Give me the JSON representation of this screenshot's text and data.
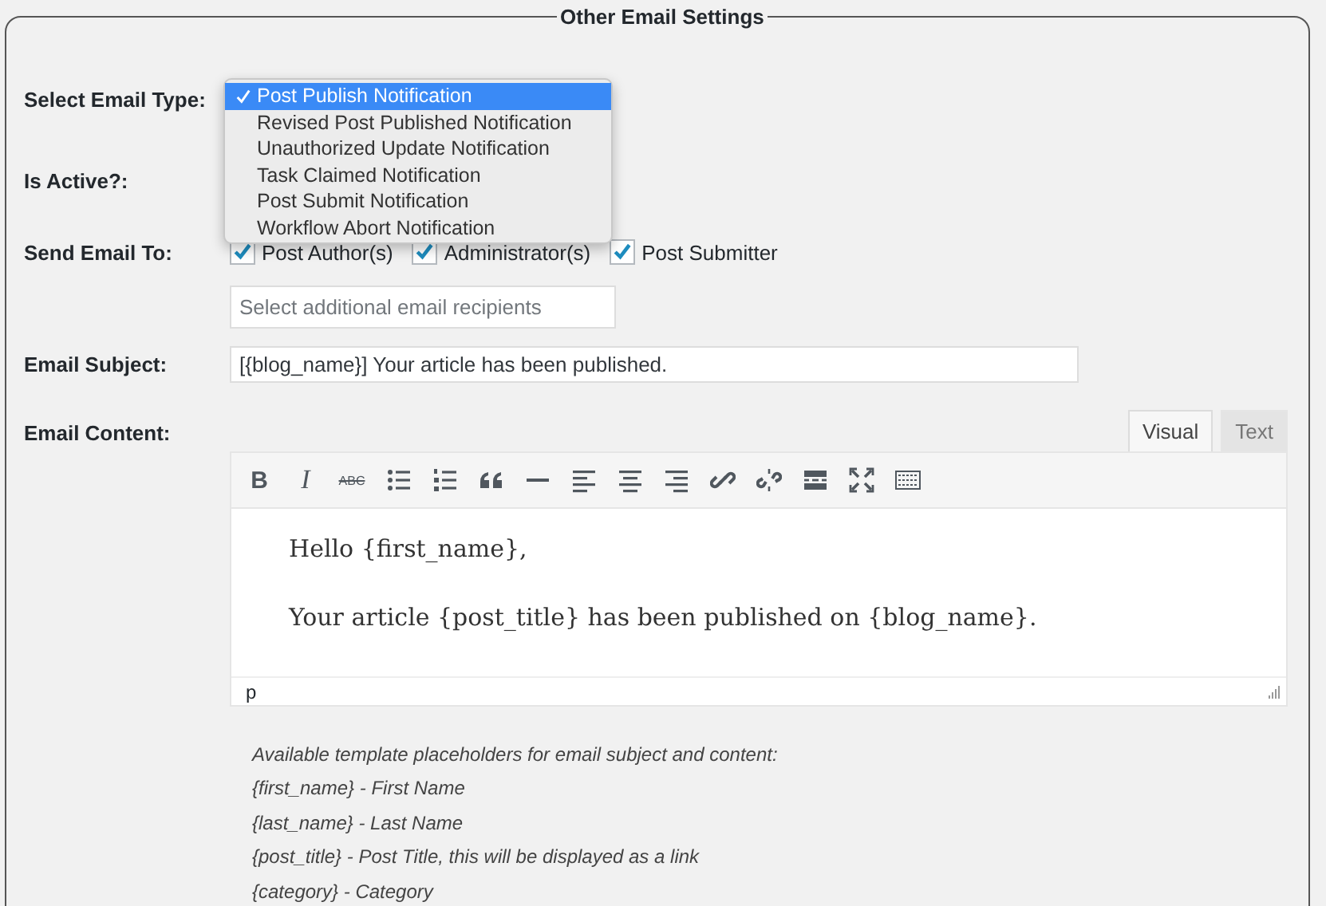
{
  "section": {
    "title": "Other Email Settings"
  },
  "email_type": {
    "label": "Select Email Type:",
    "options": [
      {
        "label": "Post Publish Notification",
        "selected": true
      },
      {
        "label": "Revised Post Published Notification",
        "selected": false
      },
      {
        "label": "Unauthorized Update Notification",
        "selected": false
      },
      {
        "label": "Task Claimed Notification",
        "selected": false
      },
      {
        "label": "Post Submit Notification",
        "selected": false
      },
      {
        "label": "Workflow Abort Notification",
        "selected": false
      }
    ]
  },
  "is_active": {
    "label": "Is Active?:"
  },
  "send_to": {
    "label": "Send Email To:",
    "recipients": [
      {
        "label": "Post Author(s)",
        "checked": true
      },
      {
        "label": "Administrator(s)",
        "checked": true
      },
      {
        "label": "Post Submitter",
        "checked": true
      }
    ],
    "additional": {
      "placeholder": "Select additional email recipients"
    }
  },
  "subject": {
    "label": "Email Subject:",
    "value": "[{blog_name}] Your article has been published."
  },
  "content": {
    "label": "Email Content:",
    "tabs": [
      {
        "label": "Visual",
        "selected": true
      },
      {
        "label": "Text",
        "selected": false
      }
    ],
    "toolbar": [
      {
        "kind": "bold",
        "label": "B"
      },
      {
        "kind": "italic",
        "label": "I"
      },
      {
        "kind": "strike",
        "label": "ABC"
      },
      {
        "kind": "bullets"
      },
      {
        "kind": "numbers"
      },
      {
        "kind": "quote"
      },
      {
        "kind": "rule"
      },
      {
        "kind": "align-left"
      },
      {
        "kind": "align-center"
      },
      {
        "kind": "align-right"
      },
      {
        "kind": "link"
      },
      {
        "kind": "unlink"
      },
      {
        "kind": "more"
      },
      {
        "kind": "fullscreen"
      },
      {
        "kind": "kitchen"
      }
    ],
    "paragraphs": [
      "Hello {first_name},",
      "Your article {post_title} has been published on {blog_name}."
    ],
    "path": "p"
  },
  "help": [
    "Available template placeholders for email subject and content:",
    "{first_name} - First Name",
    "{last_name} - Last Name",
    "{post_title} - Post Title, this will be displayed as a link",
    "{category} - Category"
  ]
}
